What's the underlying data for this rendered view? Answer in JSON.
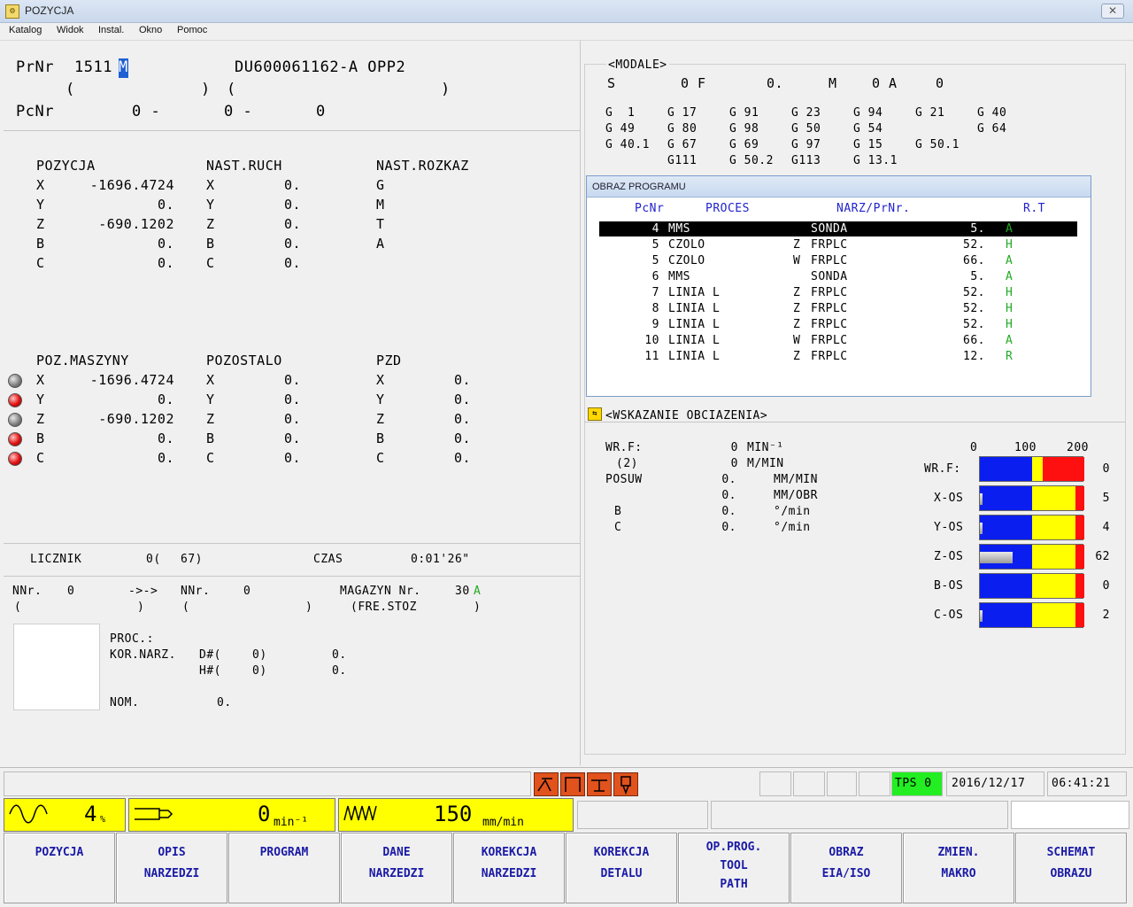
{
  "window": {
    "title": "POZYCJA",
    "close": "✕"
  },
  "menu": [
    "Katalog",
    "Widok",
    "Instal.",
    "Okno",
    "Pomoc"
  ],
  "program": {
    "prnr_label": "PrNr",
    "prnr_value": "1511",
    "prnr_cursor": "M",
    "name": "DU600061162-A OPP2",
    "paren1_open": "(",
    "paren1_close": ")",
    "paren2_open": "(",
    "paren2_close": ")",
    "pcnr_label": "PcNr",
    "pcnr_a": "0 -",
    "pcnr_b": "0 -",
    "pcnr_c": "0"
  },
  "position": {
    "headers": [
      "POZYCJA",
      "NAST.RUCH",
      "NAST.ROZKAZ"
    ],
    "rows": [
      {
        "axis": "X",
        "pos": "-1696.4724",
        "axis2": "X",
        "next": "0.",
        "cmd": "G"
      },
      {
        "axis": "Y",
        "pos": "0.",
        "axis2": "Y",
        "next": "0.",
        "cmd": "M"
      },
      {
        "axis": "Z",
        "pos": "-690.1202",
        "axis2": "Z",
        "next": "0.",
        "cmd": "T"
      },
      {
        "axis": "B",
        "pos": "0.",
        "axis2": "B",
        "next": "0.",
        "cmd": "A"
      },
      {
        "axis": "C",
        "pos": "0.",
        "axis2": "C",
        "next": "0.",
        "cmd": ""
      }
    ]
  },
  "machine": {
    "headers": [
      "POZ.MASZYNY",
      "POZOSTALO",
      "PZD"
    ],
    "rows": [
      {
        "lamp": "grey",
        "axis": "X",
        "pos": "-1696.4724",
        "axis2": "X",
        "rem": "0.",
        "axis3": "X",
        "pzd": "0."
      },
      {
        "lamp": "red",
        "axis": "Y",
        "pos": "0.",
        "axis2": "Y",
        "rem": "0.",
        "axis3": "Y",
        "pzd": "0."
      },
      {
        "lamp": "grey",
        "axis": "Z",
        "pos": "-690.1202",
        "axis2": "Z",
        "rem": "0.",
        "axis3": "Z",
        "pzd": "0."
      },
      {
        "lamp": "red",
        "axis": "B",
        "pos": "0.",
        "axis2": "B",
        "rem": "0.",
        "axis3": "B",
        "pzd": "0."
      },
      {
        "lamp": "red",
        "axis": "C",
        "pos": "0.",
        "axis2": "C",
        "rem": "0.",
        "axis3": "C",
        "pzd": "0."
      }
    ]
  },
  "counter": {
    "label": "LICZNIK",
    "value": "0(",
    "total": "67)",
    "time_label": "CZAS",
    "time": "0:01'26\""
  },
  "tool": {
    "nnr_label": "NNr.",
    "nnr_value": "0",
    "arrow": "->->",
    "nnr2_label": "NNr.",
    "nnr2_value": "0",
    "mag_label": "MAGAZYN Nr.",
    "mag_value": "30",
    "mag_flag": "A",
    "paren_a_open": "(",
    "paren_a_close": ")",
    "paren_b_open": "(",
    "paren_b_close": ")",
    "fre": "(FRE.STOZ",
    "fre_close": ")",
    "proc": "PROC.:",
    "kor": "KOR.NARZ.",
    "d_label": "D#(",
    "d_value": "0)",
    "d_val2": "0.",
    "h_label": "H#(",
    "h_value": "0)",
    "h_val2": "0.",
    "nom": "NOM.",
    "nom_value": "0."
  },
  "modal": {
    "title": "<MODALE>",
    "top": [
      "S",
      "0 F",
      "0.",
      "M",
      "0 A",
      "0"
    ],
    "g_rows": [
      [
        "G  1",
        "G 17",
        "G 91",
        "G 23",
        "G 94",
        "G 21",
        "G 40"
      ],
      [
        "G 49",
        "G 80",
        "G 98",
        "G 50",
        "G 54",
        "",
        "G 64"
      ],
      [
        "G 40.1",
        "G 67",
        "G 69",
        "G 97",
        "G 15",
        "G 50.1",
        ""
      ],
      [
        "",
        "G111",
        "G 50.2",
        "G113",
        "G 13.1",
        "",
        ""
      ]
    ]
  },
  "prog_window": {
    "title": "OBRAZ PROGRAMU",
    "headers": [
      "PcNr",
      "PROCES",
      "NARZ/PrNr.",
      "R.T"
    ],
    "rows": [
      {
        "nr": "4",
        "proc": "MMS",
        "side": "",
        "tool": "SONDA",
        "val": "5.",
        "rt": "A"
      },
      {
        "nr": "5",
        "proc": "CZOLO",
        "side": "Z",
        "tool": "FRPLC",
        "val": "52.",
        "rt": "H"
      },
      {
        "nr": "5",
        "proc": "CZOLO",
        "side": "W",
        "tool": "FRPLC",
        "val": "66.",
        "rt": "A"
      },
      {
        "nr": "6",
        "proc": "MMS",
        "side": "",
        "tool": "SONDA",
        "val": "5.",
        "rt": "A"
      },
      {
        "nr": "7",
        "proc": "LINIA L",
        "side": "Z",
        "tool": "FRPLC",
        "val": "52.",
        "rt": "H"
      },
      {
        "nr": "8",
        "proc": "LINIA L",
        "side": "Z",
        "tool": "FRPLC",
        "val": "52.",
        "rt": "H"
      },
      {
        "nr": "9",
        "proc": "LINIA L",
        "side": "Z",
        "tool": "FRPLC",
        "val": "52.",
        "rt": "H"
      },
      {
        "nr": "10",
        "proc": "LINIA L",
        "side": "W",
        "tool": "FRPLC",
        "val": "66.",
        "rt": "A"
      },
      {
        "nr": "11",
        "proc": "LINIA L",
        "side": "Z",
        "tool": "FRPLC",
        "val": "12.",
        "rt": "R"
      }
    ]
  },
  "load": {
    "title": "<WSKAZANIE OBCIAZENIA>",
    "left": [
      {
        "label": "WR.F:",
        "value": "0",
        "unit": "MIN⁻¹"
      },
      {
        "label": "(2)",
        "value": "0",
        "unit": "M/MIN"
      },
      {
        "label": "POSUW",
        "value": "0.",
        "unit": "MM/MIN"
      },
      {
        "label": "",
        "value": "0.",
        "unit": "MM/OBR"
      },
      {
        "label": "B",
        "value": "0.",
        "unit": "°/min"
      },
      {
        "label": "C",
        "value": "0.",
        "unit": "°/min"
      }
    ],
    "scale": [
      "0",
      "100",
      "200"
    ],
    "bars": [
      {
        "label": "WR.F:",
        "value": "0",
        "level": 0
      },
      {
        "label": "X-OS",
        "value": "5",
        "level": 5
      },
      {
        "label": "Y-OS",
        "value": "4",
        "level": 4
      },
      {
        "label": "Z-OS",
        "value": "62",
        "level": 62
      },
      {
        "label": "B-OS",
        "value": "0",
        "level": 0
      },
      {
        "label": "C-OS",
        "value": "2",
        "level": 2
      }
    ]
  },
  "status": {
    "tps": "TPS 0",
    "date": "2016/12/17",
    "time": "06:41:21",
    "override_pct": "4",
    "override_unit": "%",
    "spindle": "0",
    "spindle_unit": "min⁻¹",
    "feed": "150",
    "feed_unit": "mm/min"
  },
  "softkeys": [
    [
      "POZYCJA"
    ],
    [
      "OPIS",
      "NARZEDZI"
    ],
    [
      "PROGRAM"
    ],
    [
      "DANE",
      "NARZEDZI"
    ],
    [
      "KOREKCJA",
      "NARZEDZI"
    ],
    [
      "KOREKCJA",
      "DETALU"
    ],
    [
      "OP.PROG.",
      "TOOL",
      "PATH"
    ],
    [
      "OBRAZ",
      "EIA/ISO"
    ],
    [
      "ZMIEN.",
      "MAKRO"
    ],
    [
      "SCHEMAT",
      "OBRAZU"
    ]
  ],
  "colors": {
    "accent_blue": "#1e5fd2",
    "lamp_red": "#e01010",
    "bar_blue": "#0a1ef0",
    "bar_yellow": "#ffff00",
    "bar_red": "#ff1010",
    "tps_green": "#22ee22",
    "status_yellow": "#ffff00"
  }
}
